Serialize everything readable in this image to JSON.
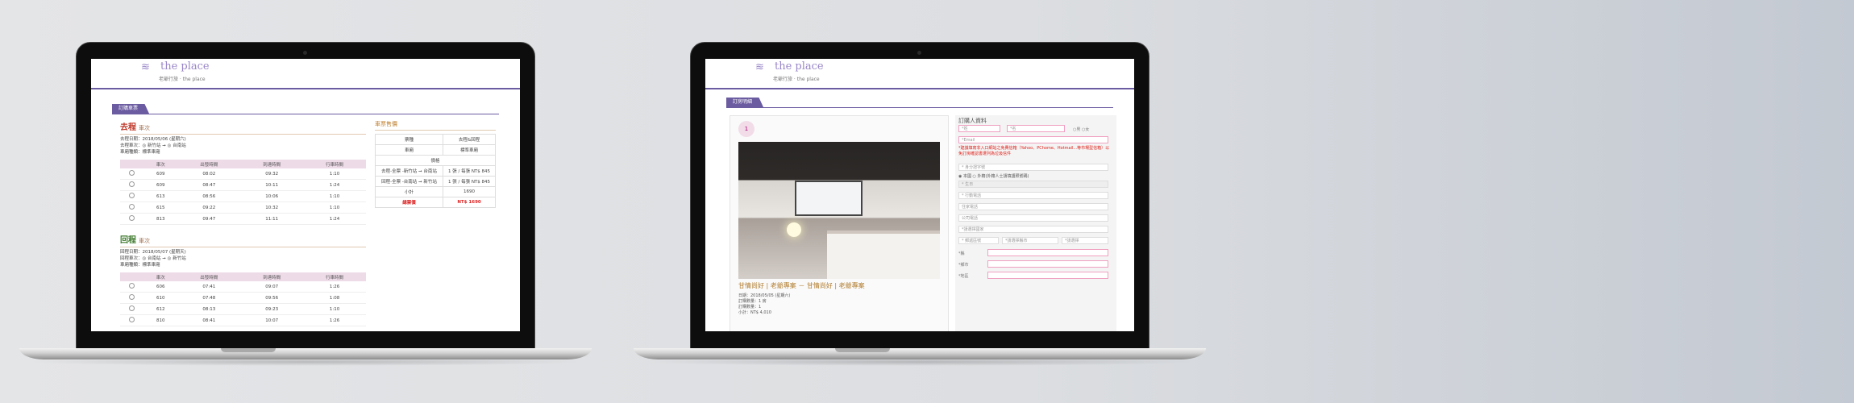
{
  "brand": {
    "logo_text": "the place",
    "logo_sub": "老爺行旅 · the place"
  },
  "screen1": {
    "tab_label": "訂購車票",
    "outbound": {
      "title": "去程",
      "subtitle": "車次",
      "lines": [
        "去程日期：2018/05/06 (星期六)",
        "去程車次：◎ 新竹站 ➞ ◎ 台南站",
        "車廂種類：標準車廂"
      ],
      "headers": [
        "",
        "車次",
        "出發時間",
        "到達時間",
        "行車時間"
      ],
      "rows": [
        [
          "609",
          "08:02",
          "09:32",
          "1:10"
        ],
        [
          "609",
          "08:47",
          "10:11",
          "1:24"
        ],
        [
          "613",
          "08:56",
          "10:06",
          "1:10"
        ],
        [
          "615",
          "09:22",
          "10:32",
          "1:10"
        ],
        [
          "813",
          "09:47",
          "11:11",
          "1:24"
        ]
      ]
    },
    "return": {
      "title": "回程",
      "subtitle": "車次",
      "lines": [
        "回程日期：2018/05/07 (星期天)",
        "回程車次：◎ 台南站 ➞ ◎ 新竹站",
        "車廂種類：標準車廂"
      ],
      "headers": [
        "",
        "車次",
        "出發時間",
        "到達時間",
        "行車時間"
      ],
      "rows": [
        [
          "606",
          "07:41",
          "09:07",
          "1:26"
        ],
        [
          "610",
          "07:48",
          "09:56",
          "1:08"
        ],
        [
          "612",
          "08:13",
          "09:23",
          "1:10"
        ],
        [
          "810",
          "08:41",
          "10:07",
          "1:26"
        ]
      ]
    },
    "fee": {
      "title": "車票售價",
      "rows": [
        [
          "票種",
          "去程&回程"
        ],
        [
          "車廂",
          "標準車廂"
        ],
        [
          "價格",
          ""
        ],
        [
          "去程-全票 -新竹站 ➞ 台南站",
          "1 張 / 每張 NT$ 845"
        ],
        [
          "回程-全票 -台南站 ➞ 新竹站",
          "1 張 / 每張 NT$ 845"
        ],
        [
          "小計",
          "1690"
        ]
      ],
      "total_label": "總票價",
      "total_value": "NT$ 1690"
    }
  },
  "screen2": {
    "tab_label": "訂房明細",
    "badge": "1",
    "room_title": "甘情尚好 | 老爺專案 － 甘情尚好 | 老爺專案",
    "room_info": [
      "日期：2018/05/05 (星期六)",
      "訂購數量：1 房",
      "訂購數量：1",
      "小計：NT$ 4,010"
    ],
    "form": {
      "title": "訂購人資料",
      "surname_ph": "*姓",
      "name_ph": "*名",
      "gender": "○男 ○女",
      "email_ph": "*Email",
      "note": "*建議填寫非入口網站之免費信箱（Yahoo、PChome、Hotmail...等市場型信箱）以免訂房確認書遭列為垃圾信件",
      "birth_ph": "* 身分證字號",
      "nationality": "◉ 本國 ○ 外籍(外籍人士請填護照號碼)",
      "id_ph": "* 生日",
      "phone_ph": "* 行動電話",
      "home_ph": "住家電話",
      "office_ph": "公司電話",
      "country_ph": "*請選擇國家",
      "zip_ph": "* 郵遞區號",
      "city_ph": "*請選擇縣市",
      "area_ph": "*請選擇",
      "label_city": "*縣",
      "label_town": "*鄉市",
      "label_addr": "*地區"
    }
  }
}
